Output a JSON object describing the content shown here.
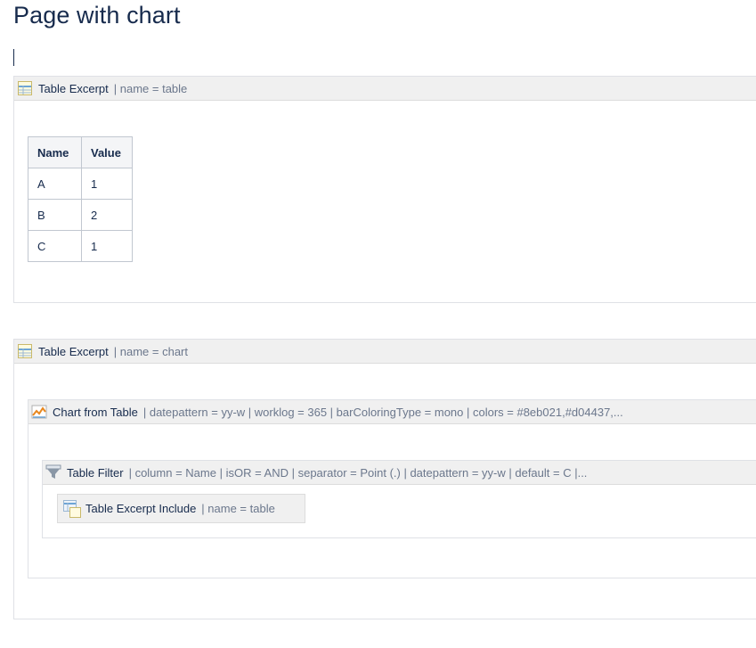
{
  "page": {
    "title": "Page with chart"
  },
  "macros": {
    "table_excerpt_1": {
      "name": "Table Excerpt",
      "params": "| name = table",
      "icon": "table-excerpt-icon"
    },
    "table_excerpt_2": {
      "name": "Table Excerpt",
      "params": "| name = chart",
      "icon": "table-excerpt-icon"
    },
    "chart_from_table": {
      "name": "Chart from Table",
      "params": "| datepattern = yy-w | worklog = 365 | barColoringType = mono | colors = #8eb021,#d04437,...",
      "icon": "chart-icon"
    },
    "table_filter": {
      "name": "Table Filter",
      "params": "| column = Name | isOR = AND | separator = Point (.) | datepattern = yy-w | default = C |...",
      "icon": "filter-funnel-icon"
    },
    "table_excerpt_include": {
      "name": "Table Excerpt Include",
      "params": "| name = table",
      "icon": "table-excerpt-include-icon"
    }
  },
  "table": {
    "headers": [
      "Name",
      "Value"
    ],
    "rows": [
      [
        "A",
        "1"
      ],
      [
        "B",
        "2"
      ],
      [
        "C",
        "1"
      ]
    ]
  }
}
